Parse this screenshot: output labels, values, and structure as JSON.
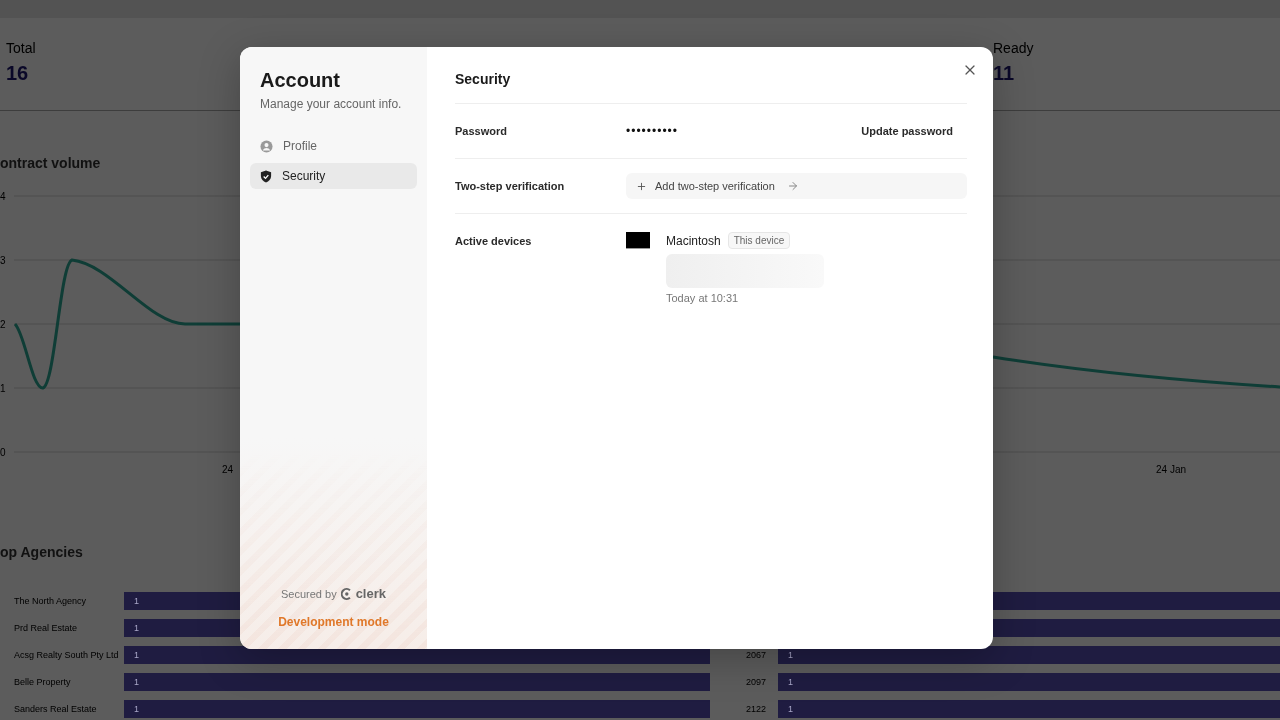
{
  "dashboard": {
    "stats": [
      {
        "label": "Total",
        "value": "16"
      },
      {
        "label": "Ready",
        "value": "11"
      }
    ],
    "contract_chart": {
      "title": "ontract volume",
      "y_ticks": [
        "4",
        "3",
        "2",
        "1",
        "0"
      ],
      "x_labels": [
        "24",
        "24 Jan"
      ]
    },
    "top_agencies": {
      "title": "op Agencies",
      "rows": [
        {
          "name": "The North Agency",
          "value": "1"
        },
        {
          "name": "Prd Real Estate",
          "value": "1"
        },
        {
          "name": "Acsg Realty South Pty Ltd",
          "value": "1",
          "column_3": "2067",
          "column_4": "1"
        },
        {
          "name": "Belle Property",
          "value": "1",
          "column_3": "2097",
          "column_4": "1"
        },
        {
          "name": "Sanders Real Estate",
          "value": "1",
          "column_3": "2122",
          "column_4": "1"
        }
      ]
    }
  },
  "modal": {
    "title": "Account",
    "subtitle": "Manage your account info.",
    "nav": [
      {
        "label": "Profile",
        "kind": "profile",
        "selected": false
      },
      {
        "label": "Security",
        "kind": "security",
        "selected": true
      }
    ],
    "footer": {
      "secured_by": "Secured by",
      "brand": "clerk",
      "mode": "Development mode"
    },
    "page": {
      "title": "Security",
      "rows": [
        {
          "kind": "password",
          "label": "Password",
          "value": "••••••••••",
          "action": "Update password"
        },
        {
          "kind": "add",
          "label": "Two-step verification",
          "action": "Add two-step verification"
        },
        {
          "kind": "devices",
          "label": "Active devices",
          "devices": [
            {
              "name": "Macintosh",
              "badge": "This device",
              "last_active": "Today at 10:31"
            }
          ]
        }
      ]
    }
  }
}
